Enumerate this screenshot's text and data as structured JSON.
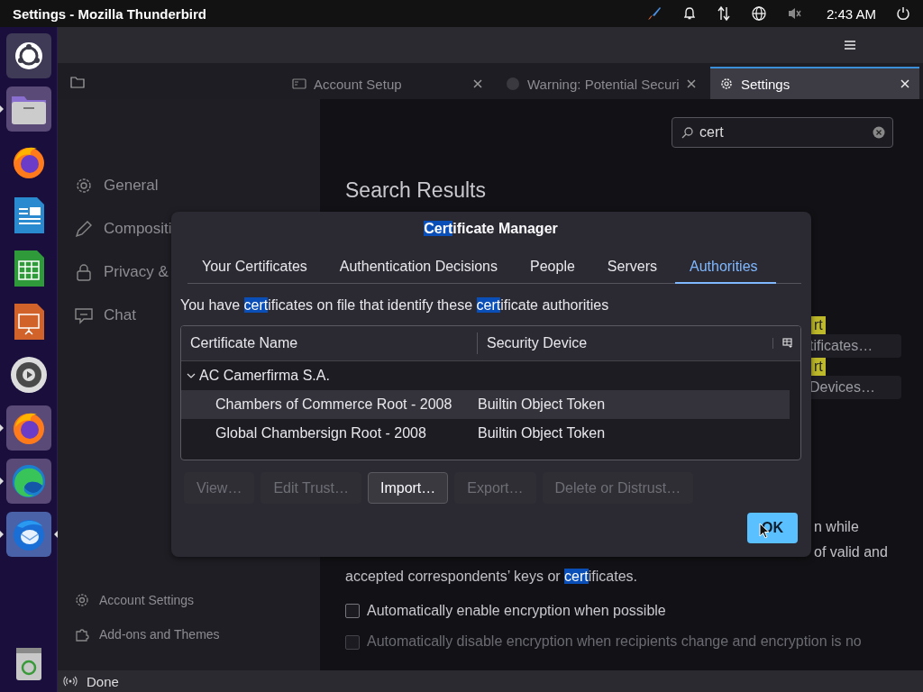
{
  "topbar": {
    "title": "Settings - Mozilla Thunderbird",
    "time": "2:43 AM"
  },
  "dock": {
    "items": [
      {
        "running": true,
        "focused": false
      },
      {
        "running": false,
        "focused": false
      },
      {
        "running": false,
        "focused": false
      },
      {
        "running": false,
        "focused": false
      },
      {
        "running": false,
        "focused": false
      },
      {
        "running": false,
        "focused": false
      },
      {
        "running": true,
        "focused": false
      },
      {
        "running": true,
        "focused": false
      },
      {
        "running": true,
        "focused": true
      }
    ]
  },
  "tabs": [
    {
      "label": "Account Setup",
      "selected": false
    },
    {
      "label": "Warning: Potential Securi",
      "selected": false
    },
    {
      "label": "Settings",
      "selected": true
    }
  ],
  "sidebar": {
    "items": [
      {
        "label": "General"
      },
      {
        "label": "Compositi"
      },
      {
        "label": "Privacy &"
      },
      {
        "label": "Chat"
      }
    ],
    "footer": [
      {
        "label": "Account Settings"
      },
      {
        "label": "Add-ons and Themes"
      }
    ]
  },
  "search": {
    "value": "cert"
  },
  "main": {
    "heading": "Search Results",
    "matches": [
      {
        "badge": "rt",
        "button": "tificates…"
      },
      {
        "badge": "rt",
        "button": "Devices…"
      }
    ],
    "fragments": [
      "n while",
      "of valid and"
    ],
    "last_line": [
      {
        "text": "accepted correspondents’ keys or ",
        "highlight": false
      },
      {
        "text": "cert",
        "highlight": true
      },
      {
        "text": "ificates.",
        "highlight": false
      }
    ],
    "checkboxes": [
      {
        "label": "Automatically enable encryption when possible",
        "checked": false,
        "disabled": false
      },
      {
        "label": "Automatically disable encryption when recipients change and encryption is no",
        "checked": false,
        "disabled": true
      }
    ]
  },
  "dialog": {
    "title": [
      {
        "text": "Cert",
        "highlight": true
      },
      {
        "text": "ificate Manager",
        "highlight": false
      }
    ],
    "tabs": [
      {
        "label": "Your Certificates",
        "selected": false
      },
      {
        "label": "Authentication Decisions",
        "selected": false
      },
      {
        "label": "People",
        "selected": false
      },
      {
        "label": "Servers",
        "selected": false
      },
      {
        "label": "Authorities",
        "selected": true
      }
    ],
    "description": [
      {
        "text": "You have ",
        "highlight": false
      },
      {
        "text": "cert",
        "highlight": true
      },
      {
        "text": "ificates on file that identify these ",
        "highlight": false
      },
      {
        "text": "cert",
        "highlight": true
      },
      {
        "text": "ificate authorities",
        "highlight": false
      }
    ],
    "columns": [
      "Certificate Name",
      "Security Device"
    ],
    "groups": [
      {
        "name": "AC Camerfirma S.A.",
        "expanded": true,
        "children": [
          {
            "name": "Chambers of Commerce Root - 2008",
            "device": "Builtin Object Token",
            "highlighted": true
          },
          {
            "name": "Global Chambersign Root - 2008",
            "device": "Builtin Object Token",
            "highlighted": false
          }
        ]
      }
    ],
    "buttons": [
      {
        "label": "View…",
        "disabled": true
      },
      {
        "label": "Edit Trust…",
        "disabled": true
      },
      {
        "label": "Import…",
        "disabled": false
      },
      {
        "label": "Export…",
        "disabled": true
      },
      {
        "label": "Delete or Distrust…",
        "disabled": true
      }
    ],
    "ok": "OK"
  },
  "status_bar": {
    "text": "Done"
  }
}
